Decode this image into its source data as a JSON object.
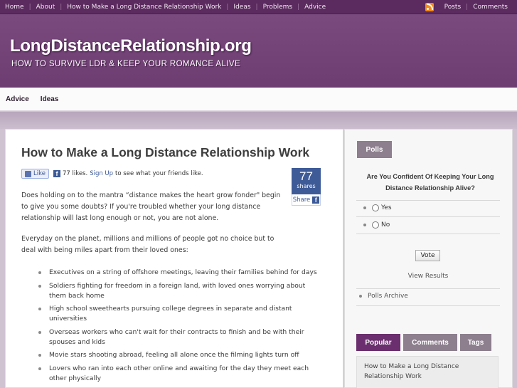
{
  "topnav": {
    "left": [
      "Home",
      "About",
      "How to Make a Long Distance Relationship Work",
      "Ideas",
      "Problems",
      "Advice"
    ],
    "right": [
      "Posts",
      "Comments"
    ],
    "rss_icon": "rss-icon"
  },
  "header": {
    "logo": "LongDistanceRelationship.org",
    "tagline": "HOW TO SURVIVE LDR & KEEP YOUR ROMANCE ALIVE"
  },
  "subnav": [
    "Advice",
    "Ideas"
  ],
  "post": {
    "title": "How to Make a Long Distance Relationship Work",
    "like_button": "Like",
    "likes_text": "77 likes.",
    "signup": "Sign Up",
    "likes_suffix": "to see what your friends like.",
    "share_count": "77",
    "share_label": "shares",
    "share_link": "Share",
    "para1": "Does holding on to the mantra “distance makes the heart grow fonder\" begin to give you some doubts? If you're troubled whether your long distance relationship will last long enough or not, you are not alone.",
    "para2": "Everyday on the planet, millions and millions of people got no choice but to deal with being miles apart from their loved ones:",
    "bullets": [
      "Executives on a string of offshore meetings, leaving their families behind for days",
      "Soldiers fighting for freedom in a foreign land, with loved ones worrying about them back home",
      "High school sweethearts pursuing college degrees in separate and distant universities",
      "Overseas workers who can't wait for their contracts to finish and be with their spouses and kids",
      "Movie stars shooting abroad, feeling all alone once the filming lights turn off",
      "Lovers who ran into each other online and awaiting for the day they meet each other physically"
    ]
  },
  "sidebar": {
    "polls_title": "Polls",
    "question": "Are You Confident Of Keeping Your Long Distance Relationship Alive?",
    "options": [
      "Yes",
      "No"
    ],
    "vote": "Vote",
    "view_results": "View Results",
    "archive": "Polls Archive",
    "tabs": [
      "Popular",
      "Comments",
      "Tags"
    ],
    "popular_item": "How to Make a Long Distance Relationship Work"
  },
  "colors": {
    "brand_purple": "#5b2a5e",
    "header_purple": "#7a4a7e",
    "tab_active": "#6b2e6e",
    "tab_inactive": "#8d7f8e",
    "facebook_blue": "#3e5b98"
  }
}
